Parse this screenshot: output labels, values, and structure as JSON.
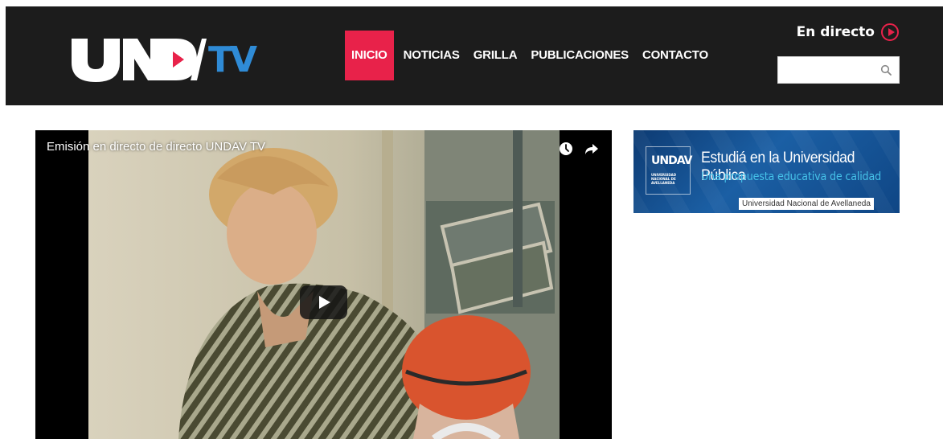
{
  "header": {
    "logo_text": "UNDAV",
    "logo_suffix": "TV",
    "nav": [
      {
        "label": "INICIO",
        "active": true
      },
      {
        "label": "NOTICIAS",
        "active": false
      },
      {
        "label": "GRILLA",
        "active": false
      },
      {
        "label": "PUBLICACIONES",
        "active": false
      },
      {
        "label": "CONTACTO",
        "active": false
      }
    ],
    "live_label": "En directo",
    "search": {
      "value": "",
      "placeholder": ""
    }
  },
  "video": {
    "title": "Emisión en directo de directo UNDAV TV",
    "icons": [
      "clock-icon",
      "share-icon",
      "play-icon"
    ]
  },
  "banner": {
    "logo_mark": "UNDAV",
    "logo_text": "UNIVERSIDAD NACIONAL DE AVELLANEDA",
    "title": "Estudiá en la Universidad Pública",
    "subtitle": "Una propuesta educativa de calidad",
    "tag": "Universidad Nacional de Avellaneda"
  },
  "colors": {
    "header_bg": "#1c1c1c",
    "accent": "#e8224a",
    "brand_blue": "#2f8bd6",
    "banner_blue": "#1b5fa4"
  }
}
